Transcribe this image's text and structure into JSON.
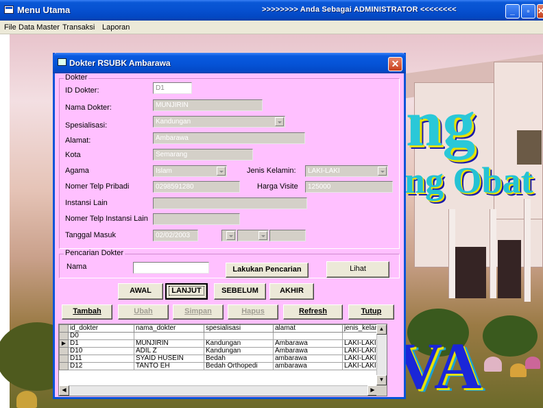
{
  "window": {
    "title": "Menu Utama",
    "status": ">>>>>>>> Anda Sebagai ADMINISTRATOR <<<<<<<<"
  },
  "menu": [
    "File",
    "Data Master",
    "Transaksi",
    "Laporan"
  ],
  "background": {
    "text_1": "ng",
    "text_2": "ng Obat",
    "text_3": "VA"
  },
  "dialog": {
    "title": "Dokter RSUBK Ambarawa",
    "close_glyph": "✕",
    "group_dokter": "Dokter",
    "fields": {
      "id_label": "ID Dokter:",
      "id_value": "D1",
      "nama_label": "Nama Dokter:",
      "nama_value": "MUNJIRIN",
      "spesialisasi_label": "Spesialisasi:",
      "spesialisasi_value": "Kandungan",
      "alamat_label": "Alamat:",
      "alamat_value": "Ambarawa",
      "kota_label": "Kota",
      "kota_value": "Semarang",
      "agama_label": "Agama",
      "agama_value": "Islam",
      "jk_label": "Jenis Kelamin:",
      "jk_value": "LAKI-LAKI",
      "telp_label": "Nomer Telp Pribadi",
      "telp_value": "0298591280",
      "visite_label": "Harga Visite",
      "visite_value": "125000",
      "instansi_label": "Instansi Lain",
      "instansi_value": "",
      "telp_instansi_label": "Nomer Telp Instansi Lain",
      "telp_instansi_value": "",
      "tgl_label": "Tanggal Masuk",
      "tgl_value": "02/02/2003"
    },
    "group_pencarian": "Pencarian Dokter",
    "search": {
      "nama_label": "Nama",
      "nama_value": "",
      "cari_button": "Lakukan Pencarian",
      "lihat_button": "Lihat"
    },
    "nav": {
      "awal": "AWAL",
      "lanjut": "LANJUT",
      "sebelum": "SEBELUM",
      "akhir": "AKHIR"
    },
    "actions": {
      "tambah": "Tambah",
      "ubah": "Ubah",
      "simpan": "Simpan",
      "hapus": "Hapus",
      "refresh": "Refresh",
      "tutup": "Tutup"
    },
    "grid": {
      "columns": [
        "id_dokter",
        "nama_dokter",
        "spesialisasi",
        "alamat",
        "jenis_kelam"
      ],
      "rows": [
        {
          "indicator": "",
          "cells": [
            "D0",
            "",
            "",
            "",
            ""
          ]
        },
        {
          "indicator": "▶",
          "cells": [
            "D1",
            "MUNJIRIN",
            "Kandungan",
            "Ambarawa",
            "LAKI-LAKI"
          ]
        },
        {
          "indicator": "",
          "cells": [
            "D10",
            "ADIL Z",
            "Kandungan",
            "Ambarawa",
            "LAKI-LAKI"
          ]
        },
        {
          "indicator": "",
          "cells": [
            "D11",
            "SYAID HUSEIN",
            "Bedah",
            "ambarawa",
            "LAKI-LAKI"
          ]
        },
        {
          "indicator": "",
          "cells": [
            "D12",
            "TANTO EH",
            "Bedah Orthopedi",
            "ambarawa",
            "LAKI-LAKI"
          ]
        }
      ]
    }
  },
  "colors": {
    "dialog_bg": "#ffc0ff",
    "titlebar_blue": "#0553d6"
  }
}
